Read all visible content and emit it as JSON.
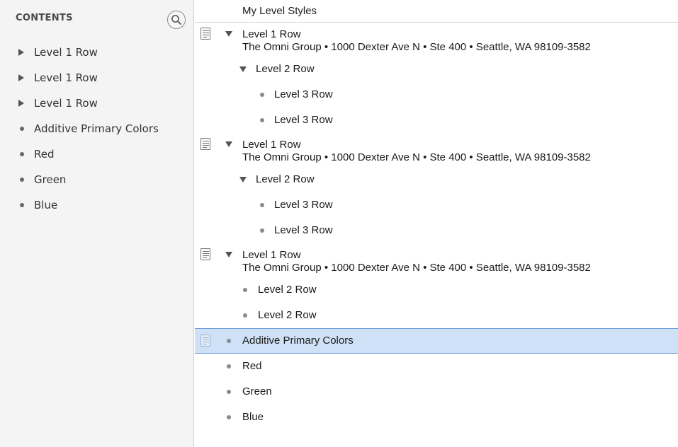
{
  "sidebar": {
    "title": "CONTENTS",
    "search_icon": "search-icon",
    "items": [
      {
        "label": "Level 1 Row",
        "marker": "disclosure-triangle"
      },
      {
        "label": "Level 1 Row",
        "marker": "disclosure-triangle"
      },
      {
        "label": "Level 1 Row",
        "marker": "disclosure-triangle"
      },
      {
        "label": "Additive Primary Colors",
        "marker": "bullet"
      },
      {
        "label": "Red",
        "marker": "bullet"
      },
      {
        "label": "Green",
        "marker": "bullet"
      },
      {
        "label": "Blue",
        "marker": "bullet"
      }
    ]
  },
  "outline": {
    "header": "My Level Styles",
    "selected_color": "#cfe1f7",
    "groups": [
      {
        "title": "Level 1 Row",
        "note": "The Omni Group • 1000 Dexter Ave N • Ste 400 • Seattle, WA 98109-3582",
        "children": [
          "Level 2 Row",
          "Level 3 Row",
          "Level 3 Row"
        ]
      },
      {
        "title": "Level 1 Row",
        "note": "The Omni Group • 1000 Dexter Ave N • Ste 400 • Seattle, WA 98109-3582",
        "children": [
          "Level 2 Row",
          "Level 3 Row",
          "Level 3 Row"
        ]
      },
      {
        "title": "Level 1 Row",
        "note": "The Omni Group • 1000 Dexter Ave N • Ste 400 • Seattle, WA 98109-3582",
        "children": [
          "Level 2 Row",
          "Level 2 Row"
        ]
      }
    ],
    "rows": [
      "Additive Primary Colors",
      "Red",
      "Green",
      "Blue"
    ]
  }
}
